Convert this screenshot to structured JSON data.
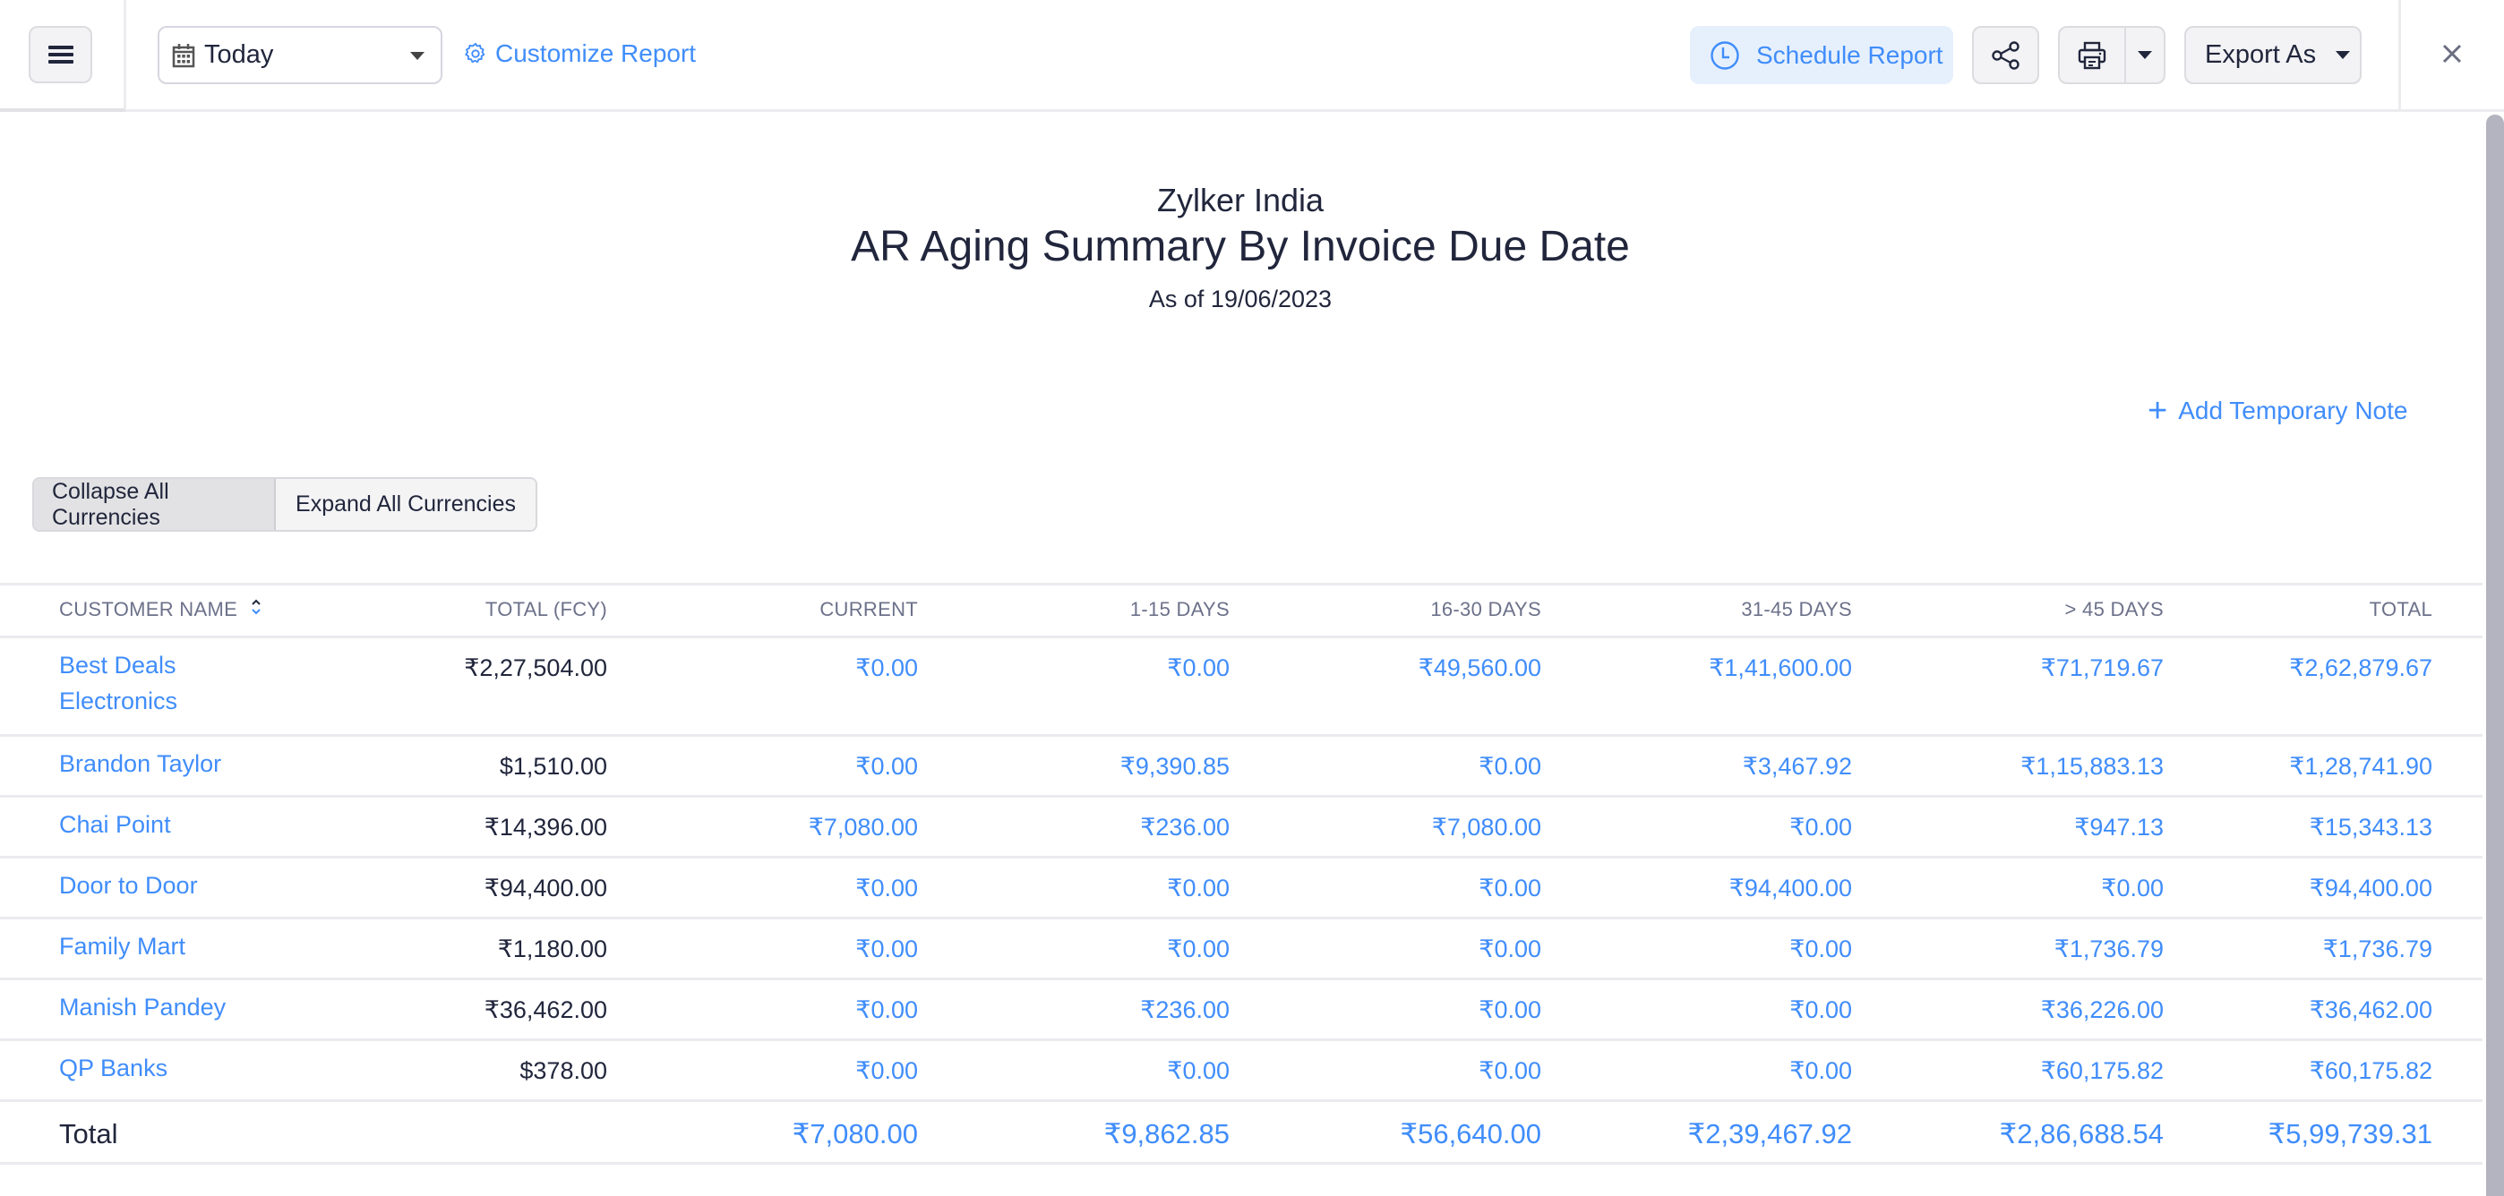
{
  "toolbar": {
    "menu_icon": "hamburger-icon",
    "date_filter": {
      "icon": "calendar-icon",
      "selected": "Today"
    },
    "customize_label": "Customize Report",
    "schedule_label": "Schedule Report",
    "share_icon": "share-icon",
    "print_icon": "printer-icon",
    "export_label": "Export As",
    "close_icon": "close-icon"
  },
  "report": {
    "organization": "Zylker India",
    "title": "AR Aging Summary By Invoice Due Date",
    "as_of": "As of 19/06/2023"
  },
  "actions": {
    "add_note_label": "Add Temporary Note",
    "collapse_label": "Collapse All Currencies",
    "expand_label": "Expand All Currencies"
  },
  "table": {
    "columns": [
      "CUSTOMER NAME",
      "TOTAL (FCY)",
      "CURRENT",
      "1-15 DAYS",
      "16-30 DAYS",
      "31-45 DAYS",
      "> 45 DAYS",
      "TOTAL"
    ],
    "rows": [
      {
        "customer": "Best Deals Electronics",
        "total_fcy": "₹2,27,504.00",
        "current": "₹0.00",
        "d1_15": "₹0.00",
        "d16_30": "₹49,560.00",
        "d31_45": "₹1,41,600.00",
        "d45_plus": "₹71,719.67",
        "total": "₹2,62,879.67"
      },
      {
        "customer": "Brandon Taylor",
        "total_fcy": "$1,510.00",
        "current": "₹0.00",
        "d1_15": "₹9,390.85",
        "d16_30": "₹0.00",
        "d31_45": "₹3,467.92",
        "d45_plus": "₹1,15,883.13",
        "total": "₹1,28,741.90"
      },
      {
        "customer": "Chai Point",
        "total_fcy": "₹14,396.00",
        "current": "₹7,080.00",
        "d1_15": "₹236.00",
        "d16_30": "₹7,080.00",
        "d31_45": "₹0.00",
        "d45_plus": "₹947.13",
        "total": "₹15,343.13"
      },
      {
        "customer": "Door to Door",
        "total_fcy": "₹94,400.00",
        "current": "₹0.00",
        "d1_15": "₹0.00",
        "d16_30": "₹0.00",
        "d31_45": "₹94,400.00",
        "d45_plus": "₹0.00",
        "total": "₹94,400.00"
      },
      {
        "customer": "Family Mart",
        "total_fcy": "₹1,180.00",
        "current": "₹0.00",
        "d1_15": "₹0.00",
        "d16_30": "₹0.00",
        "d31_45": "₹0.00",
        "d45_plus": "₹1,736.79",
        "total": "₹1,736.79"
      },
      {
        "customer": "Manish Pandey",
        "total_fcy": "₹36,462.00",
        "current": "₹0.00",
        "d1_15": "₹236.00",
        "d16_30": "₹0.00",
        "d31_45": "₹0.00",
        "d45_plus": "₹36,226.00",
        "total": "₹36,462.00"
      },
      {
        "customer": "QP Banks",
        "total_fcy": "$378.00",
        "current": "₹0.00",
        "d1_15": "₹0.00",
        "d16_30": "₹0.00",
        "d31_45": "₹0.00",
        "d45_plus": "₹60,175.82",
        "total": "₹60,175.82"
      }
    ],
    "totals": {
      "label": "Total",
      "current": "₹7,080.00",
      "d1_15": "₹9,862.85",
      "d16_30": "₹56,640.00",
      "d31_45": "₹2,39,467.92",
      "d45_plus": "₹2,86,688.54",
      "total": "₹5,99,739.31"
    }
  },
  "colors": {
    "accent": "#408dfb",
    "accent_bg": "#e6f0fd",
    "text": "#21263c",
    "header_text": "#6c718a"
  }
}
